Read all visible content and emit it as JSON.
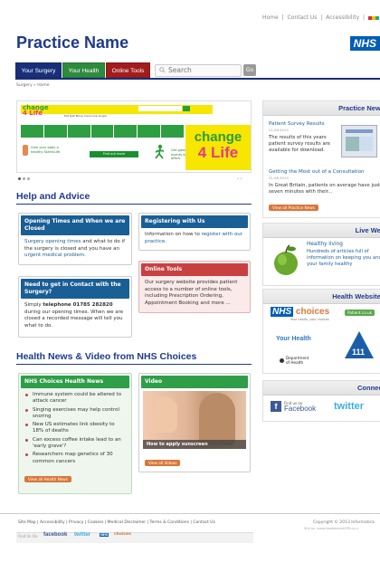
{
  "header": {
    "links": [
      "Home",
      "|",
      "Contact Us",
      "|",
      "Accessibility",
      "|"
    ],
    "practice_name": "Practice Name",
    "nhs_logo": "NHS"
  },
  "nav": {
    "tabs": [
      {
        "label": "Your Surgery",
        "color": "#1a2f7a"
      },
      {
        "label": "Your Health",
        "color": "#2e8b3d"
      },
      {
        "label": "Online Tools",
        "color": "#a11d1d"
      }
    ],
    "search_placeholder": "Search",
    "go_label": "Go"
  },
  "breadcrumb": "Surgery » Home",
  "carousel": {
    "small_logo_top": "change",
    "small_logo_bottom": "4 Life",
    "links": "Eat well   Move more   Live longer",
    "promo1": "Give your baby a healthy Start4Life",
    "find_button": "Find out more",
    "promo2": "Get going events and offers",
    "big_logo_top": "change",
    "big_logo_bottom": "4 Life",
    "arrows": "‹  ›"
  },
  "help": {
    "heading": "Help and Advice",
    "opening": {
      "title": "Opening Times and When we are Closed",
      "text1_link": "Surgery opening times",
      "text1": " and what to do if the surgery is closed and you have an ",
      "text1_link2": "urgent medical problem",
      "text1_end": "."
    },
    "registering": {
      "title": "Registering with Us",
      "text": "Information on how to ",
      "link": "register with our practice",
      "end": "."
    },
    "contact": {
      "title": "Need to get in Contact with the Surgery?",
      "text1": "Simply ",
      "bold": "telephone 01785 282820",
      "text2": " during our opening times. When we are closed a recorded message will tell you what to do."
    },
    "online": {
      "title": "Online Tools",
      "text": "Our surgery website provides patient access to a number of online tools, including Prescription Ordering, Appointment Booking and more ..."
    }
  },
  "news": {
    "heading": "Health News & Video from NHS Choices",
    "box_title": "NHS Choices Health News",
    "items": [
      "Immune system could be altered to attack cancer",
      "Singing exercises may help control snoring",
      "New US estimates link obesity to 18% of deaths",
      "Can excess coffee intake lead to an 'early grave'?",
      "Researchers map genetics of 30 common cancers"
    ],
    "all_button": "View all Health News",
    "video_title": "Video",
    "video_caption": "How to apply sunscreen",
    "video_button": "View all Videos"
  },
  "right": {
    "practice_news": {
      "title": "Practice News",
      "item1_title": "Patient Survey Results",
      "item1_date": "21.09.2013",
      "item1_text": "The results of this years patient survey results are available for download.",
      "item2_title": "Getting the Most out of a Consultation",
      "item2_date": "31.08.2013",
      "item2_text": "In Great Britain, patients on average have just seven minutes with their...",
      "button": "View all Practice News"
    },
    "live_well": {
      "title": "Live Well",
      "heading": "Healthy living",
      "text": "Hundreds of articles full of information on keeping you and your family healthy"
    },
    "health_websites": {
      "title": "Health Websites",
      "nhs_choices": "choices",
      "nhs_tag": "Your health, your choices",
      "patient": "Patient.co.uk",
      "your_health": "Your Health",
      "department": "Department of Health",
      "call111": "111"
    },
    "connect": {
      "title": "Connect",
      "find_on": "Find us on",
      "facebook": "Facebook",
      "twitter": "twitter"
    }
  },
  "footer": {
    "links": "Site Map | Accessibility | Privacy | Cookies | Medical Disclaimer | Terms & Conditions | Contact Us",
    "copyright": "Copyright © 2013 Informatica",
    "site_by": "Site by: www.howtobenetSPD.co.u",
    "find_on": "Find Us On",
    "facebook": "facebook",
    "twitter": "twitter",
    "nhs": "NHS",
    "choices": "choices"
  }
}
